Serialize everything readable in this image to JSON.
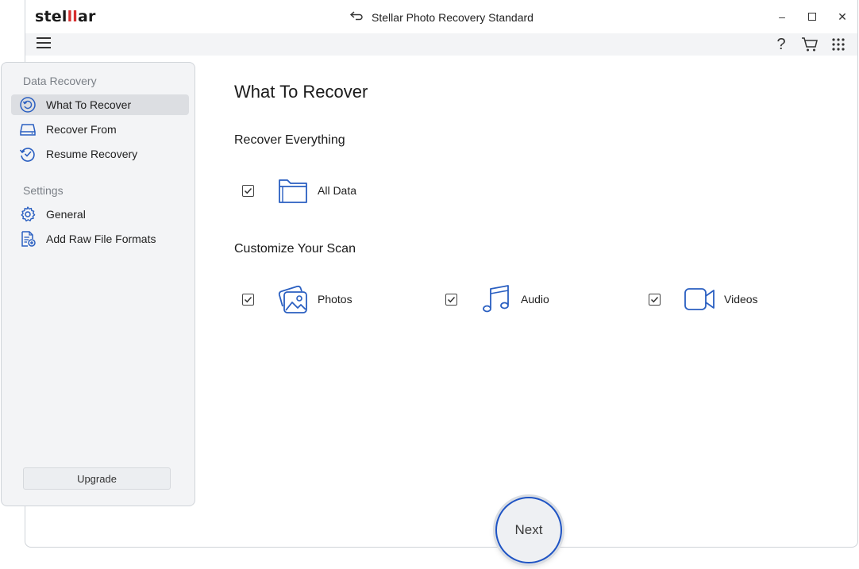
{
  "app": {
    "logo_text_a": "stel",
    "logo_text_b": "ll",
    "logo_text_c": "ar",
    "title": "Stellar Photo Recovery Standard"
  },
  "window_controls": {
    "minimize": "–",
    "maximize": "☐",
    "close": "✕"
  },
  "toolbar": {
    "help": "?"
  },
  "sidebar": {
    "data_recovery_label": "Data Recovery",
    "settings_label": "Settings",
    "items": [
      {
        "label": "What To Recover",
        "icon": "what-to-recover-icon",
        "active": true
      },
      {
        "label": "Recover From",
        "icon": "drive-icon",
        "active": false
      },
      {
        "label": "Resume Recovery",
        "icon": "resume-recovery-icon",
        "active": false
      },
      {
        "label": "General",
        "icon": "gear-icon",
        "active": false
      },
      {
        "label": "Add Raw File Formats",
        "icon": "add-file-format-icon",
        "active": false
      }
    ],
    "upgrade_label": "Upgrade"
  },
  "main": {
    "heading": "What To Recover",
    "recover_everything_label": "Recover Everything",
    "customize_label": "Customize Your Scan",
    "options": [
      {
        "label": "All Data",
        "checked": true,
        "icon": "folder-icon"
      },
      {
        "label": "Photos",
        "checked": true,
        "icon": "photos-icon"
      },
      {
        "label": "Audio",
        "checked": true,
        "icon": "music-note-icon"
      },
      {
        "label": "Videos",
        "checked": true,
        "icon": "video-camera-icon"
      }
    ],
    "next_label": "Next"
  },
  "colors": {
    "accent": "#1f54c4",
    "icon_blue": "#2a5fc1",
    "brand_red": "#d62f2f",
    "sidebar_bg": "#f3f4f6"
  }
}
